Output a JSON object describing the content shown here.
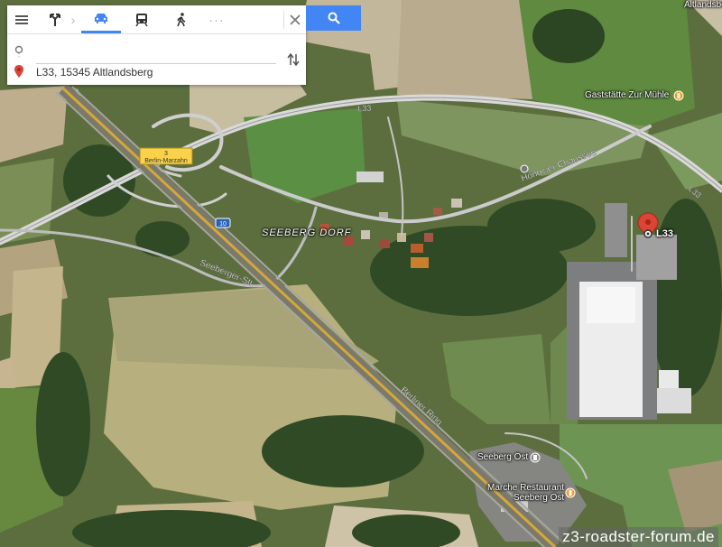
{
  "panel": {
    "menu_icon": "menu-icon",
    "modes": [
      {
        "name": "best-route",
        "icon": "directions-icon",
        "active": false
      },
      {
        "name": "driving",
        "icon": "car-icon",
        "active": true
      },
      {
        "name": "transit",
        "icon": "train-icon",
        "active": false
      },
      {
        "name": "walking",
        "icon": "walk-icon",
        "active": false
      },
      {
        "name": "more",
        "icon": "more-icon",
        "active": false
      }
    ],
    "close_icon": "close-icon",
    "search_icon": "search-icon",
    "origin": {
      "value": "",
      "placeholder": ""
    },
    "destination": {
      "value": "L33, 15345 Altlandsberg",
      "placeholder": ""
    },
    "swap_icon": "swap-icon"
  },
  "map": {
    "labels": {
      "altlandsberg": "Altlandsberg",
      "gaststaette": "Gaststätte Zur Mühle",
      "l33_road": "L33",
      "l33_road_east": "L33",
      "hoenower": "Hönower Chaussee",
      "seeberg_dorf": "SEEBERG DORF",
      "seeberger_str": "Seeberger-Str",
      "berliner_ring": "Berliner Ring",
      "seeberg_ost": "Seeberg Ost",
      "marche_line1": "Marche Restaurant",
      "marche_line2": "Seeberg Ost",
      "pin_label": "L33",
      "exit_number": "3",
      "exit_name": "Berlin-Marzahn",
      "autobahn_number": "10"
    },
    "colors": {
      "accent": "#4285f4",
      "pin": "#db4437",
      "exit_sign": "#f9d24a"
    }
  },
  "watermark": "z3-roadster-forum.de"
}
